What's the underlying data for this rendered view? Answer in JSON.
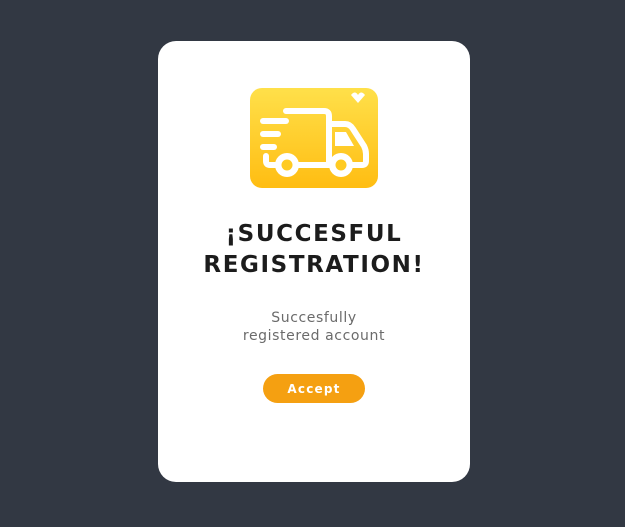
{
  "dialog": {
    "title_line1": "¡SUCCESFUL",
    "title_line2": "REGISTRATION!",
    "message_line1": "Succesfully",
    "message_line2": "registered account",
    "accept_label": "Accept",
    "icon": "delivery-truck-with-heart-icon"
  },
  "colors": {
    "background": "#323843",
    "card": "#ffffff",
    "accent": "#f5a011",
    "icon_gradient_top": "#ffe04a",
    "icon_gradient_bottom": "#ffbd12",
    "title": "#1c1c1c",
    "message": "#6b6b6b"
  }
}
